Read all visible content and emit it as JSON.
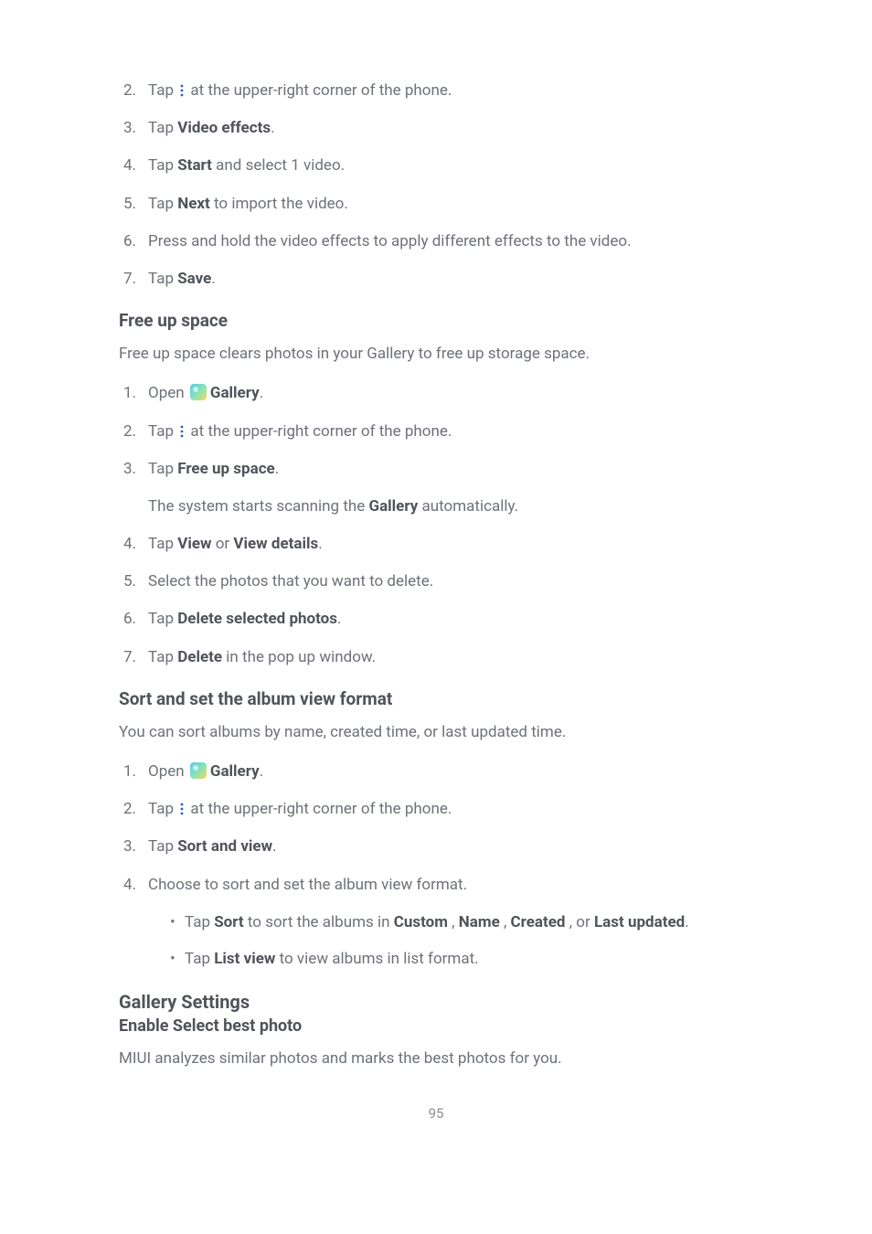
{
  "block1": {
    "items": [
      {
        "num": "2.",
        "pre": "Tap ",
        "post": " at the upper-right corner of the phone.",
        "icon": "more"
      },
      {
        "num": "3.",
        "pre": "Tap ",
        "bold": "Video effects",
        "post": "."
      },
      {
        "num": "4.",
        "pre": "Tap ",
        "bold": "Start",
        "post": " and select 1 video."
      },
      {
        "num": "5.",
        "pre": "Tap ",
        "bold": "Next",
        "post": " to import the video."
      },
      {
        "num": "6.",
        "plain": "Press and hold the video effects to apply different effects to the video."
      },
      {
        "num": "7.",
        "pre": "Tap ",
        "bold": "Save",
        "post": "."
      }
    ]
  },
  "free_up": {
    "heading": "Free up space",
    "intro": "Free up space clears photos in your Gallery to free up storage space.",
    "items": [
      {
        "num": "1.",
        "pre": "Open ",
        "icon": "gallery",
        "bold": "Gallery",
        "post": "."
      },
      {
        "num": "2.",
        "pre": "Tap ",
        "icon": "more",
        "post": " at the upper-right corner of the phone."
      },
      {
        "num": "3.",
        "pre": "Tap ",
        "bold": "Free up space",
        "post": ".",
        "inner_pre": "The system starts scanning the ",
        "inner_bold": "Gallery",
        "inner_post": " automatically."
      },
      {
        "num": "4.",
        "pre": "Tap ",
        "bold": "View",
        "mid": " or ",
        "bold2": "View details",
        "post": "."
      },
      {
        "num": "5.",
        "plain": "Select the photos that you want to delete."
      },
      {
        "num": "6.",
        "pre": "Tap ",
        "bold": "Delete selected photos",
        "post": "."
      },
      {
        "num": "7.",
        "pre": "Tap ",
        "bold": "Delete",
        "post": " in the pop up window."
      }
    ]
  },
  "sort_view": {
    "heading": "Sort and set the album view format",
    "intro": "You can sort albums by name, created time, or last updated time.",
    "items": [
      {
        "num": "1.",
        "pre": "Open ",
        "icon": "gallery",
        "bold": "Gallery",
        "post": "."
      },
      {
        "num": "2.",
        "pre": "Tap ",
        "icon": "more",
        "post": " at the upper-right corner of the phone."
      },
      {
        "num": "3.",
        "pre": "Tap ",
        "bold": "Sort and view",
        "post": "."
      },
      {
        "num": "4.",
        "plain": "Choose to sort and set the album view format.",
        "bullets": [
          {
            "t0": "Tap ",
            "b0": "Sort",
            "t1": " to sort the albums in ",
            "b1": "Custom",
            "t2": " , ",
            "b2": "Name",
            "t3": " , ",
            "b3": "Created",
            "t4": " , or ",
            "b4": "Last upda­ted",
            "t5": "."
          },
          {
            "t0": "Tap ",
            "b0": "List view",
            "t1": " to view albums in list format."
          }
        ]
      }
    ]
  },
  "gallery_settings": {
    "heading": "Gallery Settings",
    "sub": "Enable Select best photo",
    "intro": "MIUI analyzes similar photos and marks the best photos for you."
  },
  "page_number": "95"
}
